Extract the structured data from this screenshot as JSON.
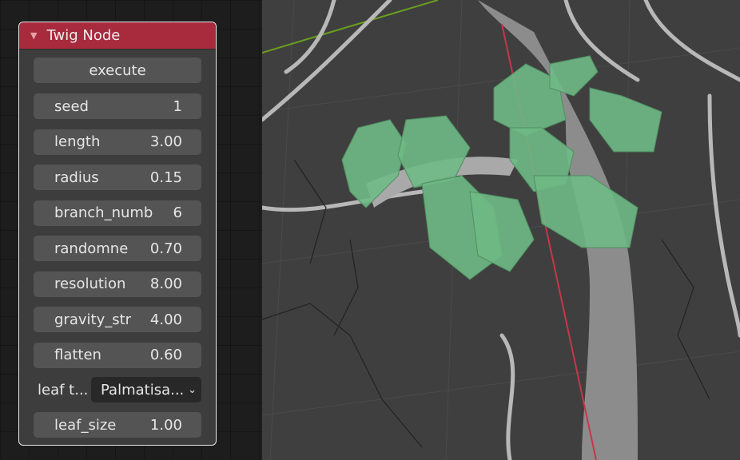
{
  "node": {
    "title": "Twig Node",
    "execute_label": "execute",
    "fields": [
      {
        "label": "seed",
        "value": "1"
      },
      {
        "label": "length",
        "value": "3.00"
      },
      {
        "label": "radius",
        "value": "0.15"
      },
      {
        "label": "branch_numb",
        "value": "6"
      },
      {
        "label": "randomne",
        "value": "0.70"
      },
      {
        "label": "resolution",
        "value": "8.00"
      },
      {
        "label": "gravity_str",
        "value": "4.00"
      },
      {
        "label": "flatten",
        "value": "0.60"
      }
    ],
    "leaf_type": {
      "label": "leaf t...",
      "value": "Palmatisa..."
    },
    "leaf_size": {
      "label": "leaf_size",
      "value": "1.00"
    }
  },
  "colors": {
    "header": "#a82a3d",
    "leaf": "#6fb985",
    "axis_x": "#c8364a",
    "axis_y": "#6a9e1f"
  }
}
